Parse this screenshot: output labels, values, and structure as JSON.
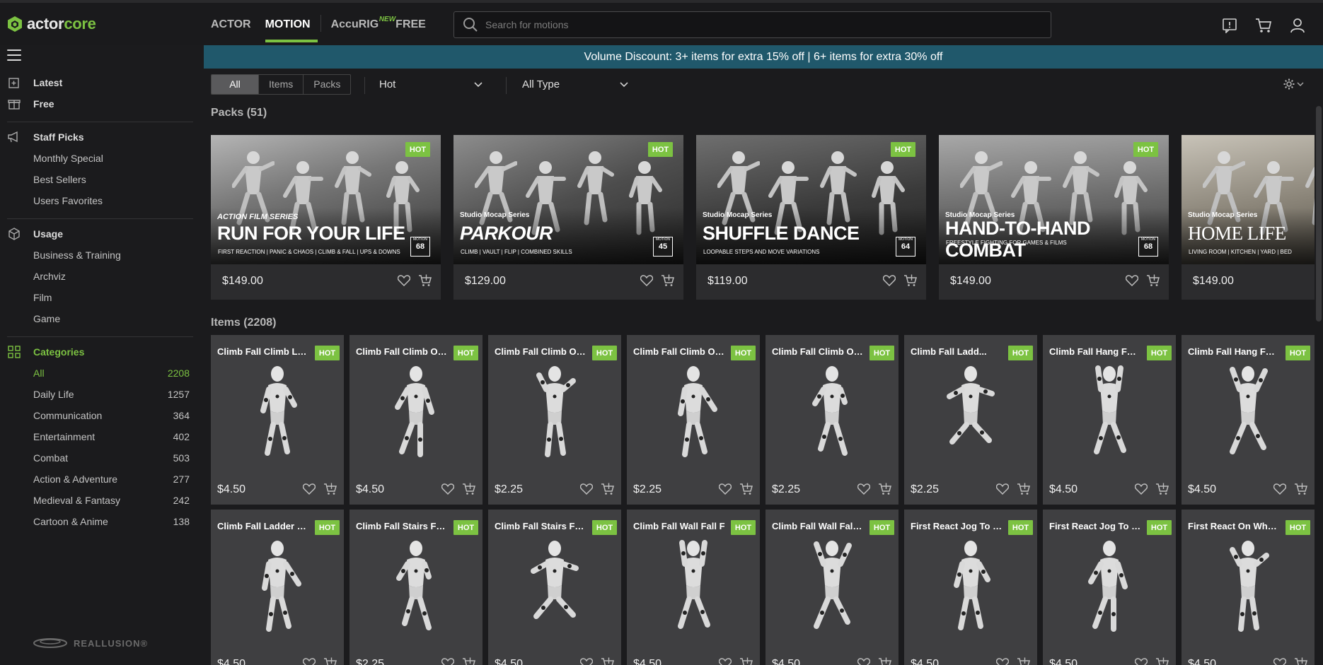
{
  "brand": {
    "name_prefix": "actor",
    "name_suffix": "core",
    "accent": "#7cc242",
    "footer_logo": "REALLUSION®"
  },
  "nav": {
    "tabs": [
      {
        "label": "ACTOR",
        "active": false
      },
      {
        "label": "MOTION",
        "active": true
      },
      {
        "label": "AccuRIG",
        "active": false,
        "badge": "NEW"
      },
      {
        "label": "FREE",
        "active": false
      }
    ]
  },
  "search": {
    "placeholder": "Search for motions",
    "value": ""
  },
  "header_icons": [
    "feedback-icon",
    "cart-icon",
    "user-icon"
  ],
  "sidebar": {
    "menu_icon": "hamburger-icon",
    "top": [
      {
        "label": "Latest",
        "icon": "new-doc-icon"
      },
      {
        "label": "Free",
        "icon": "gift-icon"
      }
    ],
    "staff_picks": {
      "label": "Staff Picks",
      "icon": "megaphone-icon",
      "items": [
        "Monthly Special",
        "Best Sellers",
        "Users Favorites"
      ]
    },
    "usage": {
      "label": "Usage",
      "icon": "box-icon",
      "items": [
        "Business & Training",
        "Archviz",
        "Film",
        "Game"
      ]
    },
    "categories": {
      "label": "Categories",
      "icon": "grid-icon",
      "items": [
        {
          "label": "All",
          "count": "2208",
          "active": true
        },
        {
          "label": "Daily Life",
          "count": "1257"
        },
        {
          "label": "Communication",
          "count": "364"
        },
        {
          "label": "Entertainment",
          "count": "402"
        },
        {
          "label": "Combat",
          "count": "503"
        },
        {
          "label": "Action & Adventure",
          "count": "277"
        },
        {
          "label": "Medieval & Fantasy",
          "count": "242"
        },
        {
          "label": "Cartoon & Anime",
          "count": "138"
        }
      ]
    }
  },
  "banner": {
    "text": "Volume Discount: 3+ items for extra 15% off | 6+ items for extra 30% off",
    "bg": "#20586b"
  },
  "filters": {
    "segments": [
      {
        "label": "All",
        "active": true
      },
      {
        "label": "Items"
      },
      {
        "label": "Packs"
      }
    ],
    "sort": "Hot",
    "type": "All Type"
  },
  "packs": {
    "title": "Packs (51)",
    "cards": [
      {
        "series": "ACTION FILM SERIES",
        "title": "RUN FOR YOUR LIFE",
        "subtitle": "FIRST REACTION | PANIC & CHAOS | CLIMB & FALL | UPS & DOWNS",
        "motion_label": "MOTION",
        "motion_count": "68",
        "price": "$149.00",
        "badge": "HOT"
      },
      {
        "series": "Studio Mocap Series",
        "title": "PARKOUR",
        "subtitle": "CLIMB | VAULT | FLIP | COMBINED SKILLS",
        "motion_label": "MOTION",
        "motion_count": "45",
        "price": "$129.00",
        "badge": "HOT"
      },
      {
        "series": "Studio Mocap Series",
        "title": "SHUFFLE DANCE",
        "subtitle": "LOOPABLE STEPS AND MOVE VARIATIONS",
        "motion_label": "MOTION",
        "motion_count": "64",
        "price": "$119.00",
        "badge": "HOT"
      },
      {
        "series": "Studio Mocap Series",
        "title": "HAND-TO-HAND COMBAT",
        "subtitle": "FREESTYLE FIGHTING FOR GAMES & FILMS",
        "motion_label": "MOTION",
        "motion_count": "68",
        "price": "$149.00",
        "badge": "HOT"
      },
      {
        "series": "Studio Mocap Series",
        "title": "HOME LIFE",
        "subtitle": "LIVING ROOM  |  KITCHEN  |  YARD  |  BED",
        "motion_label": "MOTION",
        "motion_count": "",
        "price": "$149.00",
        "badge": "HOT"
      }
    ]
  },
  "items": {
    "title": "Items (2208)",
    "cards": [
      {
        "name": "Climb Fall Climb La...",
        "price": "$4.50",
        "badge": "HOT"
      },
      {
        "name": "Climb Fall Climb Ov...",
        "price": "$4.50",
        "badge": "HOT"
      },
      {
        "name": "Climb Fall Climb Ov...",
        "price": "$2.25",
        "badge": "HOT"
      },
      {
        "name": "Climb Fall Climb Ov...",
        "price": "$2.25",
        "badge": "HOT"
      },
      {
        "name": "Climb Fall Climb Ov...",
        "price": "$2.25",
        "badge": "HOT"
      },
      {
        "name": "Climb Fall Ladd...",
        "price": "$2.25",
        "badge": "HOT"
      },
      {
        "name": "Climb Fall Hang Fall F",
        "price": "$4.50",
        "badge": "HOT"
      },
      {
        "name": "Climb Fall Hang Fall...",
        "price": "$4.50",
        "badge": "HOT"
      },
      {
        "name": "Climb Fall Ladder Tr...",
        "price": "$4.50",
        "badge": "HOT"
      },
      {
        "name": "Climb Fall Stairs Fal...",
        "price": "$2.25",
        "badge": "HOT"
      },
      {
        "name": "Climb Fall Stairs Fal...",
        "price": "$4.50",
        "badge": "HOT"
      },
      {
        "name": "Climb Fall Wall Fall F",
        "price": "$4.50",
        "badge": "HOT"
      },
      {
        "name": "Climb Fall Wall Fall M",
        "price": "$4.50",
        "badge": "HOT"
      },
      {
        "name": "First React Jog To R...",
        "price": "$4.50",
        "badge": "HOT"
      },
      {
        "name": "First React Jog To R...",
        "price": "$4.50",
        "badge": "HOT"
      },
      {
        "name": "First React On Whee...",
        "price": "$4.50",
        "badge": "HOT"
      }
    ]
  }
}
